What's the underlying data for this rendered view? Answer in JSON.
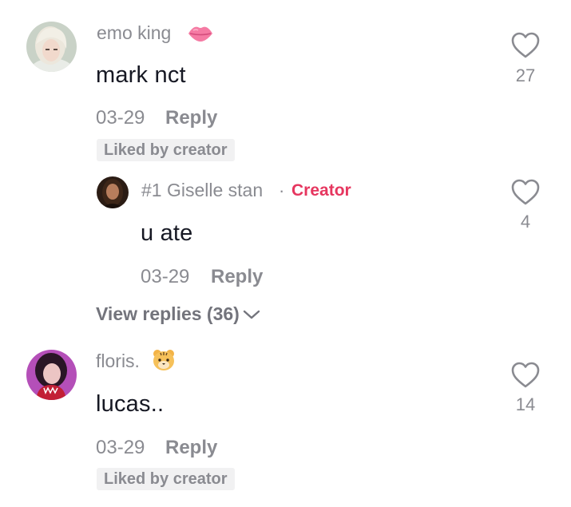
{
  "comments": [
    {
      "username": "emo king",
      "username_emoji": "lips-icon",
      "text": "mark nct",
      "date": "03-29",
      "reply_label": "Reply",
      "liked_label": "Liked by creator",
      "like_count": "27"
    },
    {
      "username": "floris.",
      "username_emoji": "tiger-face-icon",
      "text": "lucas..",
      "date": "03-29",
      "reply_label": "Reply",
      "liked_label": "Liked by creator",
      "like_count": "14"
    }
  ],
  "reply": {
    "username": "#1 Giselle stan",
    "separator": "·",
    "creator_label": "Creator",
    "text": "u ate",
    "date": "03-29",
    "reply_label": "Reply",
    "like_count": "4"
  },
  "view_replies_label": "View replies (36)",
  "colors": {
    "creator_accent": "#e6365f",
    "muted_text": "#8a8b91",
    "body_text": "#161823",
    "badge_bg": "#f1f1f2"
  }
}
